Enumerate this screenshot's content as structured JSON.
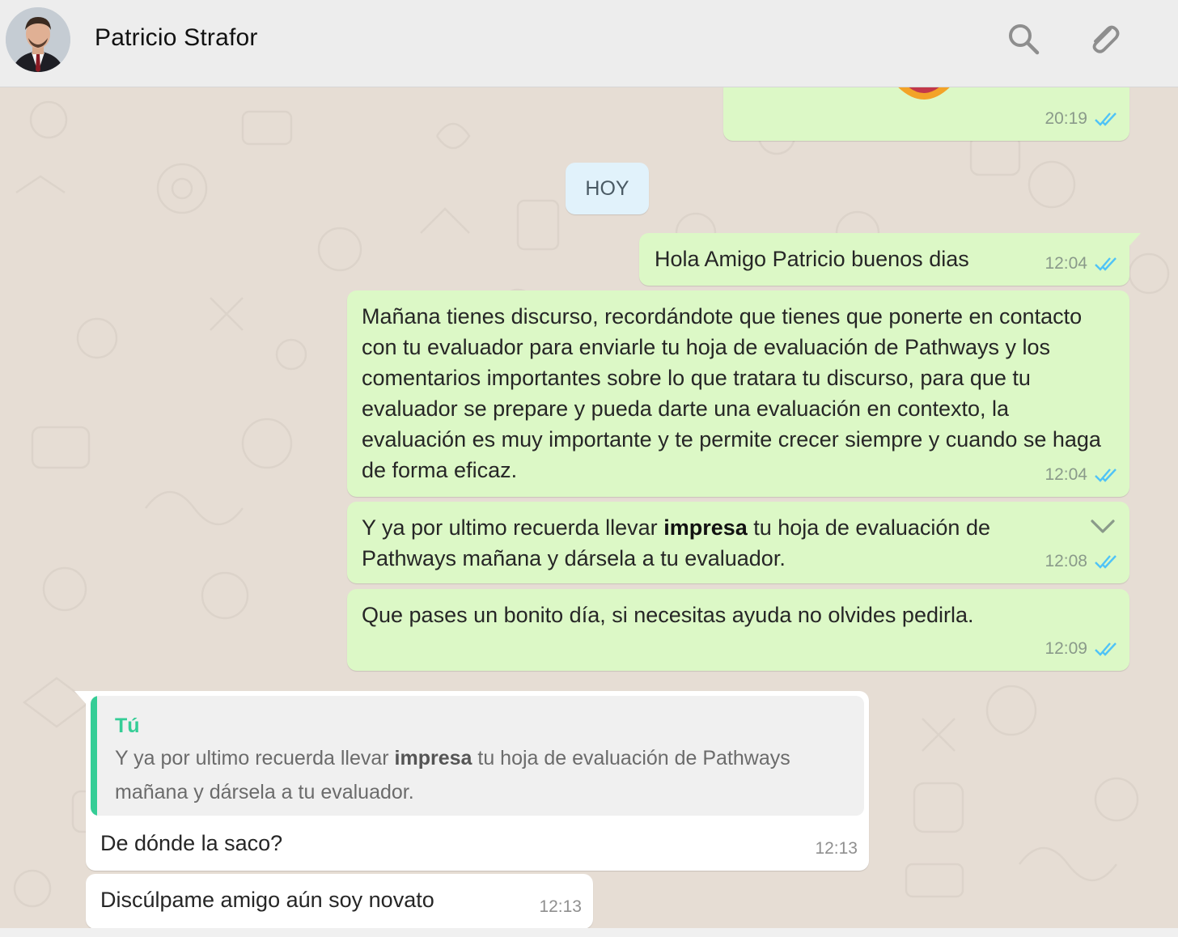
{
  "header": {
    "contact_name": "Patricio Strafor",
    "avatar_icon": "profile-photo",
    "search_icon": "search-icon",
    "attach_icon": "paperclip-icon"
  },
  "colors": {
    "outgoing_bubble": "#dcf8c6",
    "incoming_bubble": "#ffffff",
    "read_ticks": "#4fc3f7",
    "quote_accent": "#35cd96",
    "day_pill": "#e1f2fb"
  },
  "day_divider": "HOY",
  "messages": {
    "m0": {
      "time": "20:19",
      "status": "read"
    },
    "m1": {
      "text": "Hola Amigo Patricio buenos dias",
      "time": "12:04",
      "status": "read"
    },
    "m2": {
      "text": "Mañana tienes discurso, recordándote que tienes que ponerte en contacto con tu evaluador para enviarle tu hoja de evaluación de Pathways y los comentarios importantes sobre lo que tratara tu discurso, para que tu evaluador se prepare y pueda darte una evaluación en contexto, la evaluación es muy importante y te permite crecer siempre y cuando se haga de forma eficaz.",
      "time": "12:04",
      "status": "read"
    },
    "m3": {
      "text_before": "Y ya por ultimo recuerda llevar ",
      "text_bold": "impresa",
      "text_after": " tu hoja de evaluación de Pathways mañana y dársela a tu evaluador.",
      "time": "12:08",
      "status": "read"
    },
    "m4": {
      "text": "Que pases un bonito día, si necesitas ayuda no olvides pedirla.",
      "time": "12:09",
      "status": "read"
    },
    "m5": {
      "quote_author": "Tú",
      "quote_before": "Y ya por ultimo recuerda llevar ",
      "quote_bold": "impresa",
      "quote_after": " tu hoja de evaluación de Pathways mañana y dársela a tu evaluador.",
      "text": "De dónde la saco?",
      "time": "12:13"
    },
    "m6": {
      "text": "Discúlpame amigo aún soy novato",
      "time": "12:13"
    }
  }
}
